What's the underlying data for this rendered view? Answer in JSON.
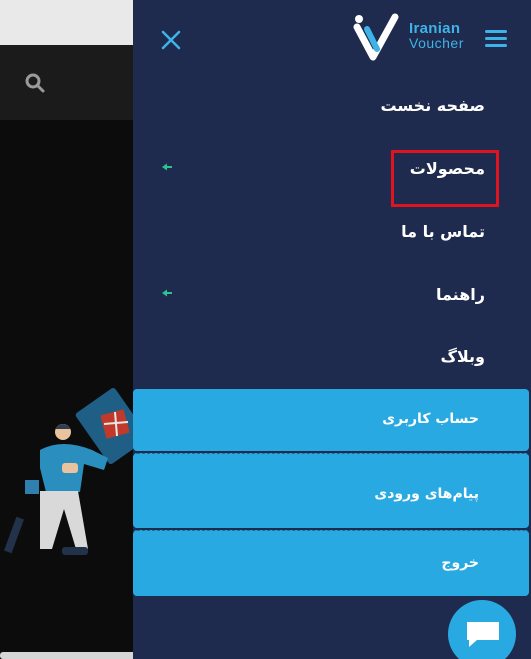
{
  "brand": {
    "name_line1": "Iranian",
    "name_line2": "Voucher",
    "accent_color": "#3fb3e8",
    "panel_color": "#1e2b4e",
    "button_color": "#29a9e1",
    "highlight_color": "#e0141e"
  },
  "icons": {
    "close": "close-icon",
    "menu": "hamburger-icon",
    "search": "search-icon",
    "submenu": "arrow-left-icon",
    "chat": "chat-icon"
  },
  "menu": {
    "items": [
      {
        "label": "صفحه نخست",
        "has_submenu": false
      },
      {
        "label": "محصولات",
        "has_submenu": true,
        "highlighted": true
      },
      {
        "label": "تماس با ما",
        "has_submenu": false
      },
      {
        "label": "راهنما",
        "has_submenu": true
      },
      {
        "label": "وبلاگ",
        "has_submenu": false
      }
    ]
  },
  "account_buttons": {
    "account": "حساب کاربری",
    "messages": "پیام‌های ورودی",
    "logout": "خروج"
  }
}
